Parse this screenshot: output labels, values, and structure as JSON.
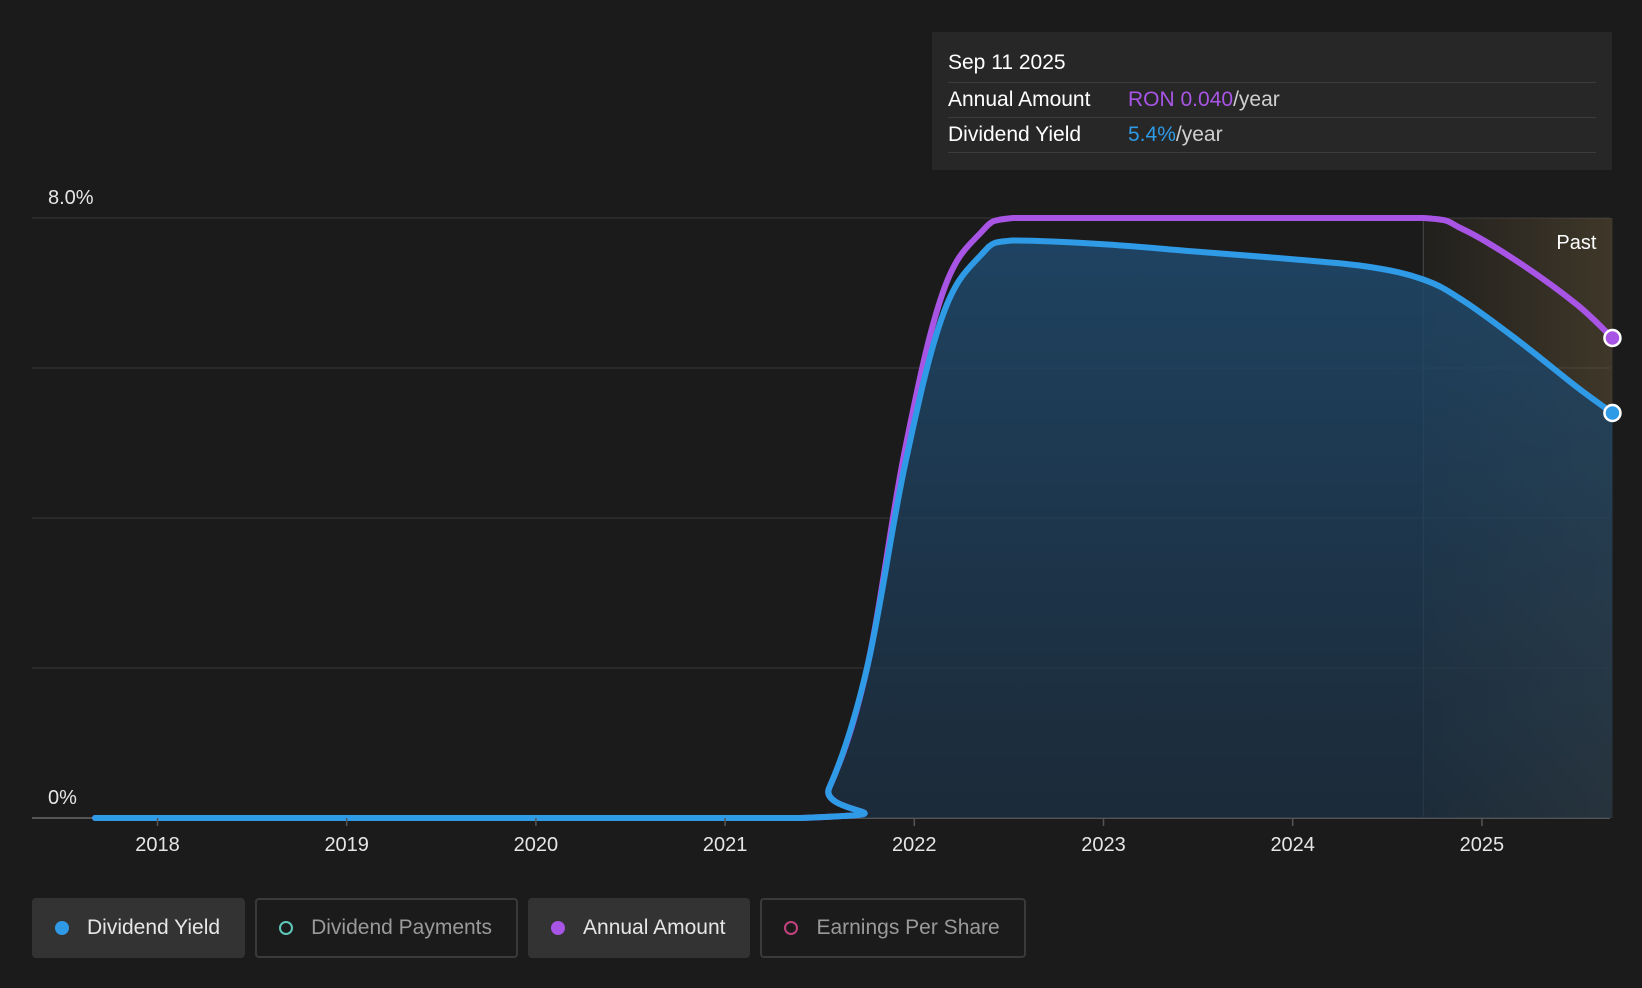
{
  "tooltip": {
    "date": "Sep 11 2025",
    "rows": [
      {
        "label": "Annual Amount",
        "value": "RON 0.040",
        "unit": "/year"
      },
      {
        "label": "Dividend Yield",
        "value": "5.4%",
        "unit": "/year"
      }
    ]
  },
  "past_label": "Past",
  "legend": [
    {
      "label": "Dividend Yield",
      "color": "#2f9ae6",
      "active": true
    },
    {
      "label": "Dividend Payments",
      "color": "#5ec8b8",
      "active": false
    },
    {
      "label": "Annual Amount",
      "color": "#a855e6",
      "active": true
    },
    {
      "label": "Earnings Per Share",
      "color": "#c2427e",
      "active": false
    }
  ],
  "chart_data": {
    "type": "area",
    "ylim": [
      0,
      8
    ],
    "y_tick_labels": [
      "0%",
      "8.0%"
    ],
    "x_tick_labels": [
      "2018",
      "2019",
      "2020",
      "2021",
      "2022",
      "2023",
      "2024",
      "2025"
    ],
    "xlim": [
      2017.67,
      2025.69
    ],
    "past_start": 2024.69,
    "colors": {
      "dividend_yield": "#2f9ae6",
      "annual_amount": "#a855e6"
    },
    "series": [
      {
        "name": "Annual Amount",
        "x": [
          2017.67,
          2021.4,
          2021.55,
          2021.75,
          2021.95,
          2022.15,
          2022.35,
          2022.52,
          2023.0,
          2024.0,
          2024.69,
          2024.9,
          2025.2,
          2025.5,
          2025.69
        ],
        "values": [
          0,
          0,
          0.4,
          2.0,
          4.9,
          7.0,
          7.8,
          8.0,
          8.0,
          8.0,
          8.0,
          7.85,
          7.4,
          6.85,
          6.4
        ]
      },
      {
        "name": "Dividend Yield",
        "x": [
          2017.67,
          2021.4,
          2021.55,
          2021.75,
          2021.95,
          2022.15,
          2022.35,
          2022.52,
          2023.0,
          2023.5,
          2024.0,
          2024.4,
          2024.69,
          2024.9,
          2025.2,
          2025.5,
          2025.69
        ],
        "values": [
          0,
          0,
          0.4,
          2.0,
          4.7,
          6.7,
          7.5,
          7.7,
          7.65,
          7.55,
          7.45,
          7.35,
          7.18,
          6.9,
          6.35,
          5.75,
          5.4
        ]
      }
    ]
  }
}
